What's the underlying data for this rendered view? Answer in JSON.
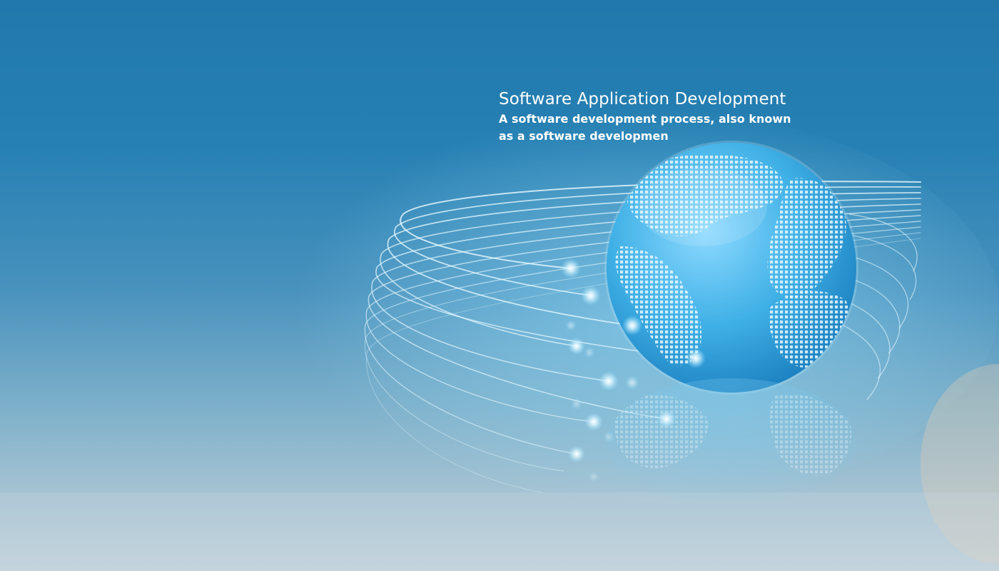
{
  "slide": {
    "title": "Software Application Development",
    "text": "A software development process, also known as a software developmen"
  },
  "art": {
    "subject": "globe-with-fiber-optic-strands",
    "icon": "globe-icon"
  },
  "colors": {
    "sky_top": "#2178ab",
    "sky_bottom": "#c4d3dc",
    "glow": "#9fe4ff",
    "globe": "#3fb0e6",
    "text": "#ffffff"
  }
}
